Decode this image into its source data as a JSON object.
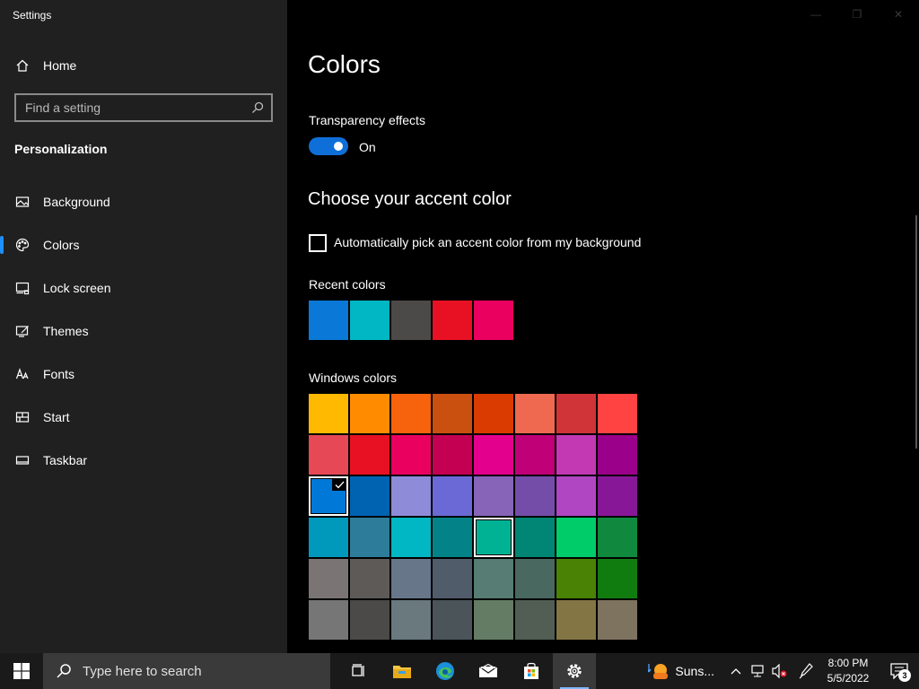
{
  "window": {
    "title": "Settings",
    "controls": {
      "minimize": "—",
      "maximize": "❐",
      "close": "✕"
    }
  },
  "sidebar": {
    "home_label": "Home",
    "search_placeholder": "Find a setting",
    "section_title": "Personalization",
    "items": [
      {
        "label": "Background",
        "icon": "picture-icon",
        "active": false
      },
      {
        "label": "Colors",
        "icon": "palette-icon",
        "active": true
      },
      {
        "label": "Lock screen",
        "icon": "lock-screen-icon",
        "active": false
      },
      {
        "label": "Themes",
        "icon": "themes-icon",
        "active": false
      },
      {
        "label": "Fonts",
        "icon": "fonts-icon",
        "active": false
      },
      {
        "label": "Start",
        "icon": "start-icon",
        "active": false
      },
      {
        "label": "Taskbar",
        "icon": "taskbar-icon",
        "active": false
      }
    ]
  },
  "main": {
    "title": "Colors",
    "transparency": {
      "label": "Transparency effects",
      "state": "On",
      "enabled": true
    },
    "accent_heading": "Choose your accent color",
    "auto_pick": {
      "label": "Automatically pick an accent color from my background",
      "checked": false
    },
    "recent_label": "Recent colors",
    "recent_colors": [
      "#0a78d7",
      "#00b7c3",
      "#4c4a48",
      "#e81123",
      "#ea005e"
    ],
    "windows_label": "Windows colors",
    "windows_colors": [
      [
        "#ffb900",
        "#ff8c00",
        "#f7630c",
        "#ca5010",
        "#da3b01",
        "#ef6950",
        "#d13438",
        "#ff4343"
      ],
      [
        "#e74856",
        "#e81123",
        "#ea005e",
        "#c30052",
        "#e3008c",
        "#bf0077",
        "#c239b3",
        "#9a0089"
      ],
      [
        "#0078d7",
        "#0063b1",
        "#8e8cd8",
        "#6b69d6",
        "#8764b8",
        "#744da9",
        "#b146c2",
        "#881798"
      ],
      [
        "#0099bc",
        "#2d7d9a",
        "#00b7c3",
        "#038387",
        "#00b294",
        "#018574",
        "#00cc6a",
        "#10893e"
      ],
      [
        "#7a7574",
        "#5d5a58",
        "#68768a",
        "#515c6b",
        "#567c73",
        "#486860",
        "#498205",
        "#107c10"
      ],
      [
        "#767676",
        "#4c4a48",
        "#69797e",
        "#4a5459",
        "#647c64",
        "#525e54",
        "#847545",
        "#7e735f"
      ]
    ],
    "selected_color": {
      "row": 2,
      "col": 0
    },
    "hovered_color": {
      "row": 3,
      "col": 4
    }
  },
  "taskbar": {
    "search_placeholder": "Type here to search",
    "apps": [
      "task-view-icon",
      "file-explorer-icon",
      "edge-icon",
      "mail-icon",
      "store-icon",
      "settings-icon"
    ],
    "weather": "Suns...",
    "time": "8:00 PM",
    "date": "5/5/2022",
    "notification_count": "3"
  }
}
